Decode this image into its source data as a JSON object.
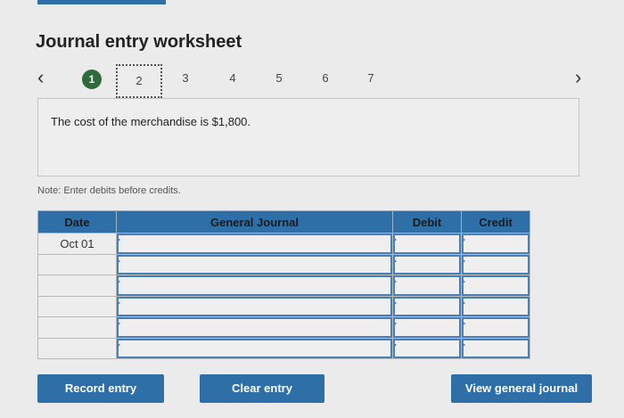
{
  "title": "Journal entry worksheet",
  "nav": {
    "prev_icon": "‹",
    "next_icon": "›",
    "steps": [
      "1",
      "2",
      "3",
      "4",
      "5",
      "6",
      "7"
    ]
  },
  "description": "The cost of the merchandise is $1,800.",
  "note": "Note: Enter debits before credits.",
  "table": {
    "headers": {
      "date": "Date",
      "journal": "General Journal",
      "debit": "Debit",
      "credit": "Credit"
    },
    "rows": [
      {
        "date": "Oct 01",
        "account": "",
        "debit": "",
        "credit": ""
      },
      {
        "date": "",
        "account": "",
        "debit": "",
        "credit": ""
      },
      {
        "date": "",
        "account": "",
        "debit": "",
        "credit": ""
      },
      {
        "date": "",
        "account": "",
        "debit": "",
        "credit": ""
      },
      {
        "date": "",
        "account": "",
        "debit": "",
        "credit": ""
      },
      {
        "date": "",
        "account": "",
        "debit": "",
        "credit": ""
      }
    ]
  },
  "buttons": {
    "record": "Record entry",
    "clear": "Clear entry",
    "view": "View general journal"
  },
  "colors": {
    "accent": "#2f6fa8",
    "done_step": "#2e6b3a",
    "background": "#ebebeb"
  }
}
